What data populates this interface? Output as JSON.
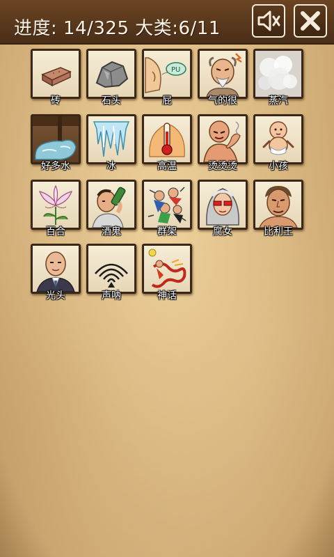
{
  "header": {
    "progress_text": "进度: 14/325 大类:6/11"
  },
  "items": [
    {
      "label": "砖",
      "icon": "brick-icon"
    },
    {
      "label": "石头",
      "icon": "stone-icon"
    },
    {
      "label": "屁",
      "icon": "fart-icon"
    },
    {
      "label": "气的很",
      "icon": "angry-man-icon"
    },
    {
      "label": "蒸汽",
      "icon": "steam-icon"
    },
    {
      "label": "好多水",
      "icon": "water-flood-icon"
    },
    {
      "label": "冰",
      "icon": "ice-icon"
    },
    {
      "label": "高温",
      "icon": "thermometer-icon"
    },
    {
      "label": "烫烫烫",
      "icon": "burned-man-icon"
    },
    {
      "label": "小孩",
      "icon": "baby-icon"
    },
    {
      "label": "百合",
      "icon": "lily-icon"
    },
    {
      "label": "酒鬼",
      "icon": "drunk-icon"
    },
    {
      "label": "群架",
      "icon": "brawl-icon"
    },
    {
      "label": "腐女",
      "icon": "fujoshi-icon"
    },
    {
      "label": "比利王",
      "icon": "billy-icon"
    },
    {
      "label": "光头",
      "icon": "bald-man-icon"
    },
    {
      "label": "声呐",
      "icon": "sonar-icon"
    },
    {
      "label": "神话",
      "icon": "myth-icon"
    }
  ]
}
